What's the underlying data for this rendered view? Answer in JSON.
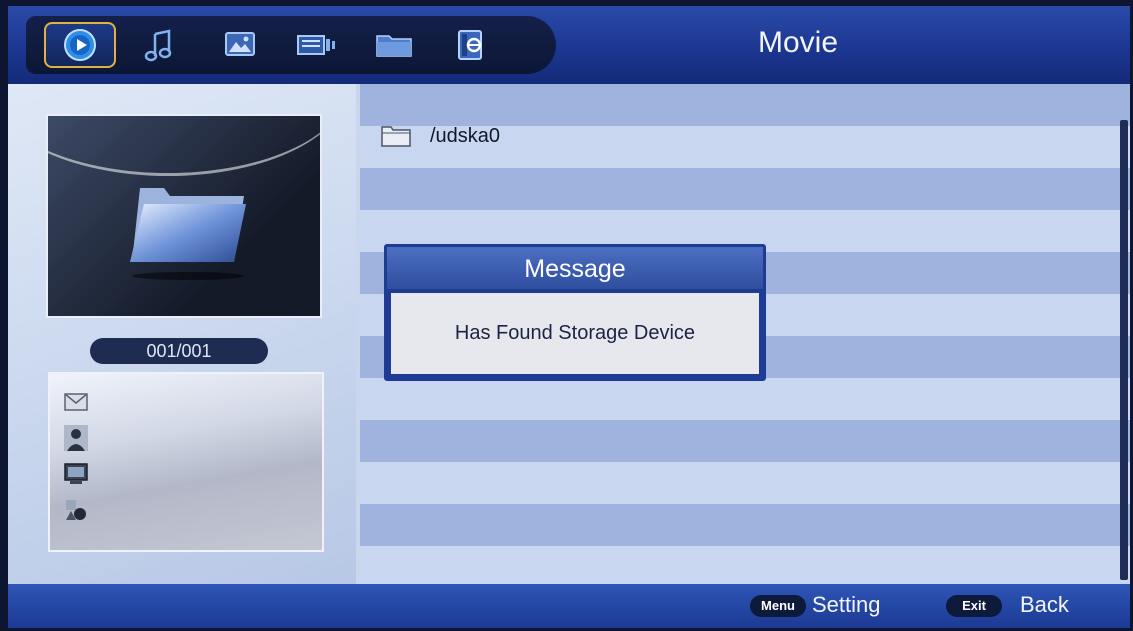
{
  "header": {
    "title": "Movie",
    "tabs": [
      {
        "name": "movie",
        "icon": "play-circle-icon",
        "active": true
      },
      {
        "name": "music",
        "icon": "music-note-icon",
        "active": false
      },
      {
        "name": "photo",
        "icon": "photo-icon",
        "active": false
      },
      {
        "name": "text",
        "icon": "text-document-icon",
        "active": false
      },
      {
        "name": "files",
        "icon": "folder-icon",
        "active": false
      },
      {
        "name": "ebook",
        "icon": "ebook-icon",
        "active": false
      }
    ]
  },
  "left_panel": {
    "preview_icon": "folder-icon",
    "counter": "001/001",
    "info_icons": [
      "envelope-icon",
      "person-icon",
      "monitor-icon",
      "shapes-icon"
    ]
  },
  "file_list": {
    "items": [
      {
        "icon": "folder-icon",
        "label": "/udska0"
      }
    ]
  },
  "dialog": {
    "title": "Message",
    "message": "Has Found Storage Device"
  },
  "footer": {
    "menu_key": "Menu",
    "menu_label": "Setting",
    "exit_key": "Exit",
    "exit_label": "Back"
  },
  "colors": {
    "accent": "#e0b245",
    "header_blue": "#1c3792",
    "dialog_blue": "#1f3c94"
  }
}
